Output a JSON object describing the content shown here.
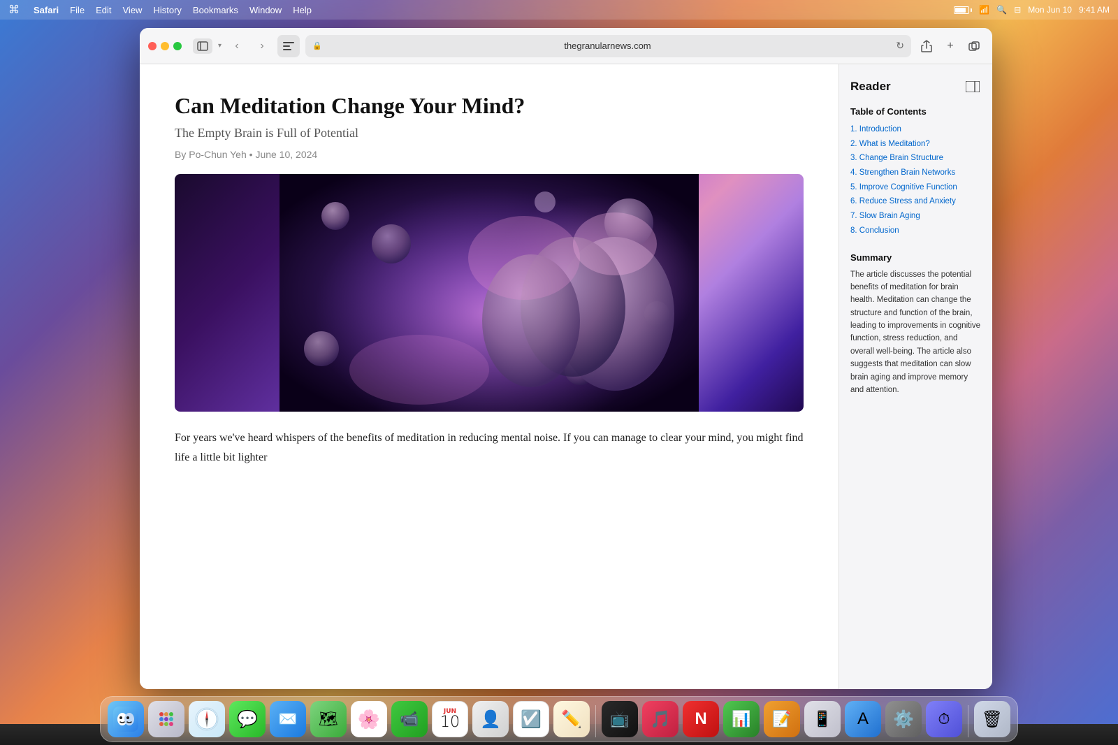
{
  "desktop": {
    "time": "9:41 AM",
    "date": "Mon Jun 10",
    "battery_level": "80%"
  },
  "menubar": {
    "apple": "⌘",
    "app_name": "Safari",
    "menus": [
      "File",
      "Edit",
      "View",
      "History",
      "Bookmarks",
      "Window",
      "Help"
    ]
  },
  "safari": {
    "url": "thegranularnews.com",
    "reader_button_label": "📰",
    "back_button": "‹",
    "forward_button": "›",
    "reload_button": "↻",
    "share_button": "↑",
    "new_tab_button": "+",
    "tabs_button": "⧉"
  },
  "article": {
    "title": "Can Meditation Change Your Mind?",
    "subtitle": "The Empty Brain is Full of Potential",
    "byline": "By Po-Chun Yeh",
    "date": "June 10, 2024",
    "body_text": "For years we've heard whispers of the benefits of meditation in reducing mental noise. If you can manage to clear your mind, you might find life a little bit lighter"
  },
  "reader_panel": {
    "title": "Reader",
    "toc_heading": "Table of Contents",
    "toc_items": [
      "1. Introduction",
      "2. What is Meditation?",
      "3. Change Brain Structure",
      "4. Strengthen Brain Networks",
      "5. Improve Cognitive Function",
      "6. Reduce Stress and Anxiety",
      "7. Slow Brain Aging",
      "8. Conclusion"
    ],
    "summary_heading": "Summary",
    "summary_text": "The article discusses the potential benefits of meditation for brain health. Meditation can change the structure and function of the brain, leading to improvements in cognitive function, stress reduction, and overall well-being. The article also suggests that meditation can slow brain aging and improve memory and attention."
  },
  "dock": {
    "icons": [
      {
        "name": "Finder",
        "key": "finder",
        "emoji": "🟦"
      },
      {
        "name": "Launchpad",
        "key": "launchpad",
        "emoji": "⊞"
      },
      {
        "name": "Safari",
        "key": "safari",
        "emoji": "🌐"
      },
      {
        "name": "Messages",
        "key": "messages",
        "emoji": "💬"
      },
      {
        "name": "Mail",
        "key": "mail",
        "emoji": "✉"
      },
      {
        "name": "Maps",
        "key": "maps",
        "emoji": "🗺"
      },
      {
        "name": "Photos",
        "key": "photos",
        "emoji": "🌸"
      },
      {
        "name": "FaceTime",
        "key": "facetime",
        "emoji": "📹"
      },
      {
        "name": "Calendar",
        "key": "calendar",
        "emoji": "10"
      },
      {
        "name": "Contacts",
        "key": "contacts",
        "emoji": "👤"
      },
      {
        "name": "Reminders",
        "key": "reminders",
        "emoji": "☑"
      },
      {
        "name": "Freeform",
        "key": "freeform",
        "emoji": "✏"
      },
      {
        "name": "Apple TV",
        "key": "appletv",
        "emoji": "📺"
      },
      {
        "name": "Music",
        "key": "music",
        "emoji": "♪"
      },
      {
        "name": "News",
        "key": "news",
        "emoji": "N"
      },
      {
        "name": "Numbers",
        "key": "numbers",
        "emoji": "#"
      },
      {
        "name": "Pages",
        "key": "pages",
        "emoji": "📄"
      },
      {
        "name": "iPhone Mirror",
        "key": "iphone",
        "emoji": "📱"
      },
      {
        "name": "App Store",
        "key": "appstore",
        "emoji": "A"
      },
      {
        "name": "System Settings",
        "key": "settings",
        "emoji": "⚙"
      },
      {
        "name": "Screen Time",
        "key": "screentime",
        "emoji": "⏱"
      },
      {
        "name": "Trash",
        "key": "trash",
        "emoji": "🗑"
      }
    ]
  }
}
